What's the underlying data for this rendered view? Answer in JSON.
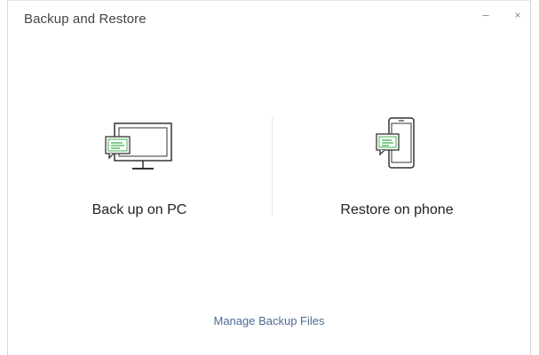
{
  "window": {
    "title": "Backup and Restore",
    "minimize_symbol": "–",
    "close_symbol": "×"
  },
  "options": {
    "backup_pc": {
      "label": "Back up on PC",
      "icon": "monitor-chat-icon"
    },
    "restore_phone": {
      "label": "Restore on phone",
      "icon": "phone-chat-icon"
    }
  },
  "footer": {
    "manage_label": "Manage Backup Files"
  },
  "colors": {
    "accent_green": "#3fb34f",
    "link": "#4c6a94",
    "icon_stroke": "#333333"
  }
}
